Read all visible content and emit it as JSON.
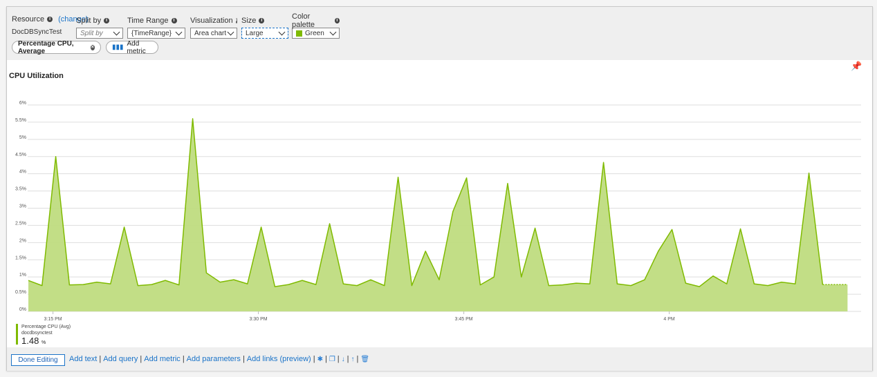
{
  "params": {
    "resource": {
      "label": "Resource",
      "change": "(change)",
      "value": "DocDBSyncTest"
    },
    "split_by": {
      "label": "Split by",
      "placeholder": "Split by"
    },
    "time_range": {
      "label": "Time Range",
      "value": "{TimeRange}"
    },
    "visualization": {
      "label": "Visualization",
      "value": "Area chart"
    },
    "size": {
      "label": "Size",
      "value": "Large"
    },
    "color_palette": {
      "label": "Color palette",
      "value": "Green",
      "swatch": "#7fba00"
    }
  },
  "metric_pill": "Percentage CPU, Average",
  "add_metric": "Add metric",
  "icons": {
    "info": "info-icon",
    "pin": "pin-icon",
    "settings": "gear-icon",
    "copy": "copy-icon",
    "down": "arrow-down-icon",
    "up": "arrow-up-icon",
    "delete": "trash-icon"
  },
  "chart_data": {
    "type": "area",
    "title": "CPU Utilization",
    "color": "#7fba00",
    "fill": "#bfdc80",
    "grid": true,
    "ylim": [
      0,
      6
    ],
    "yticks": [
      "0%",
      "0.5%",
      "1%",
      "1.5%",
      "2%",
      "2.5%",
      "3%",
      "3.5%",
      "4%",
      "4.5%",
      "5%",
      "5.5%",
      "6%"
    ],
    "xticks": [
      "3:15 PM",
      "3:30 PM",
      "3:45 PM",
      "4 PM"
    ],
    "x_start": "3:13 PM",
    "x_interval": "1 min",
    "series": [
      {
        "name": "Percentage CPU (Avg)",
        "values": [
          0.9,
          0.75,
          4.5,
          0.77,
          0.78,
          0.85,
          0.8,
          2.45,
          0.75,
          0.78,
          0.9,
          0.77,
          5.6,
          1.12,
          0.85,
          0.92,
          0.8,
          2.45,
          0.72,
          0.78,
          0.9,
          0.78,
          2.55,
          0.8,
          0.75,
          0.92,
          0.75,
          3.9,
          0.75,
          1.75,
          0.92,
          2.9,
          3.88,
          0.77,
          1.0,
          3.72,
          1.0,
          2.42,
          0.75,
          0.77,
          0.82,
          0.8,
          4.33,
          0.8,
          0.75,
          0.92,
          1.75,
          2.38,
          0.82,
          0.72,
          1.03,
          0.8,
          2.4,
          0.8,
          0.75,
          0.85,
          0.8,
          4.02,
          0.78
        ]
      }
    ],
    "legend": {
      "name": "Percentage CPU (Avg)",
      "resource": "docdbsynctest",
      "value": "1.48",
      "unit": "%"
    }
  },
  "footer": {
    "done": "Done Editing",
    "links": [
      "Add text",
      "Add query",
      "Add metric",
      "Add parameters",
      "Add links (preview)"
    ]
  }
}
